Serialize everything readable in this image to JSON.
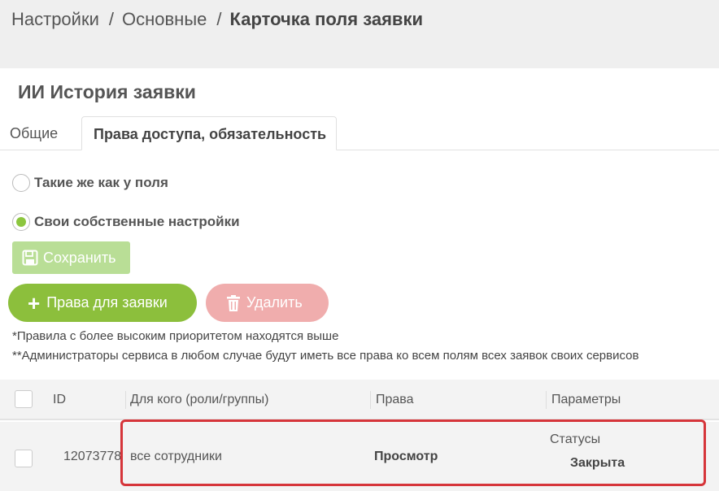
{
  "breadcrumb": {
    "item1": "Настройки",
    "item2": "Основные",
    "current": "Карточка поля заявки",
    "separator": "/"
  },
  "page": {
    "title": "ИИ История заявки"
  },
  "tabs": [
    {
      "label": "Общие",
      "active": false
    },
    {
      "label": "Права доступа, обязательность",
      "active": true
    }
  ],
  "access": {
    "option_same": "Такие же как у поля",
    "option_own": "Свои собственные настройки",
    "selected": "own"
  },
  "buttons": {
    "save": "Сохранить",
    "add_rights": "Права для заявки",
    "delete": "Удалить"
  },
  "notes": {
    "note1": "*Правила с более высоким приоритетом находятся выше",
    "note2": "**Администраторы сервиса в любом случае будут иметь все права ко всем полям всех заявок своих сервисов"
  },
  "table": {
    "columns": {
      "id": "ID",
      "for_whom": "Для кого (роли/группы)",
      "rights": "Права",
      "params": "Параметры"
    },
    "rows": [
      {
        "id": "12073778",
        "for_whom": "все сотрудники",
        "rights": "Просмотр",
        "params_label": "Статусы",
        "params_value": "Закрыта"
      }
    ]
  },
  "colors": {
    "accent_green": "#8cbf3c",
    "save_green": "#b9de96",
    "delete_red": "#f0adad",
    "highlight_red": "#d6353a"
  }
}
